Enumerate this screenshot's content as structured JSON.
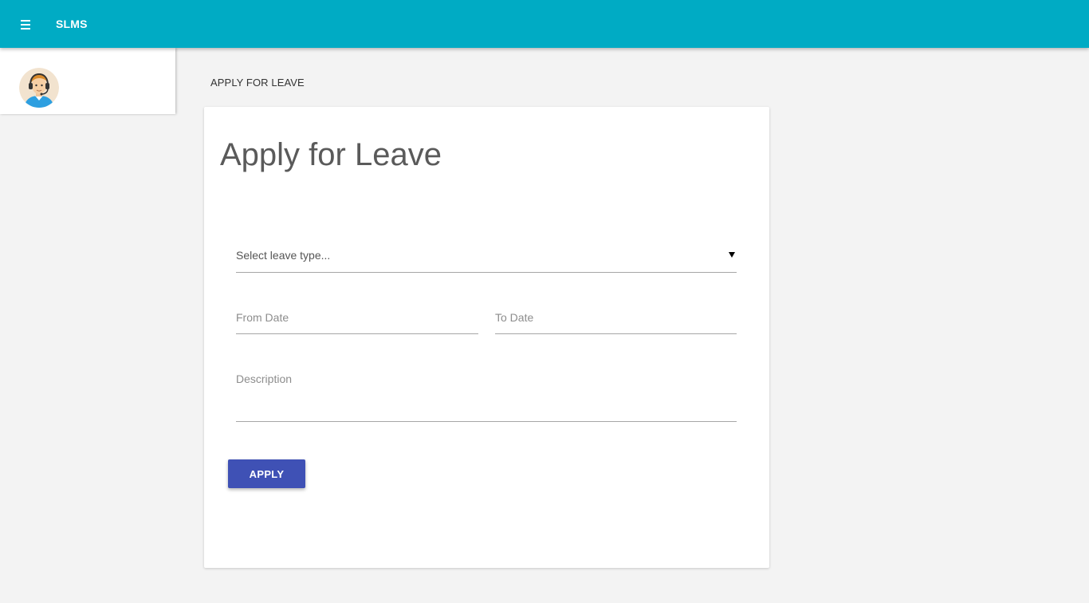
{
  "app": {
    "brand": "SLMS",
    "menu_icon": "hamburger-menu-icon",
    "accent_color": "#00abc4"
  },
  "sidebar": {
    "avatar_icon": "user-headset-avatar"
  },
  "page": {
    "heading": "APPLY FOR LEAVE"
  },
  "form": {
    "title": "Apply for Leave",
    "leave_type_placeholder": "Select leave type...",
    "from_date_placeholder": "From Date",
    "to_date_placeholder": "To Date",
    "description_placeholder": "Description",
    "apply_label": "APPLY",
    "apply_color": "#3f51b5"
  }
}
